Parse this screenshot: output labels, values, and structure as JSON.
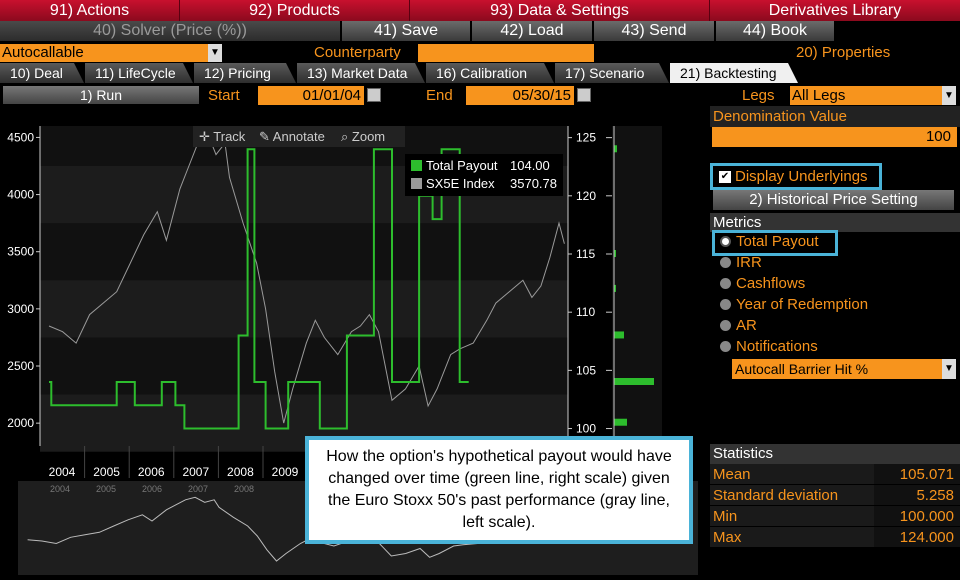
{
  "menu": [
    "91) Actions",
    "92) Products",
    "93) Data & Settings",
    "Derivatives Library"
  ],
  "toolbar": [
    "40) Solver (Price (%))",
    "41) Save",
    "42) Load",
    "43) Send",
    "44) Book"
  ],
  "row3": {
    "product": "Autocallable",
    "counterparty_label": "Counterparty",
    "counterparty_value": "",
    "properties": "20) Properties"
  },
  "tabs": [
    "10) Deal",
    "11) LifeCycle",
    "12) Pricing",
    "13) Market Data",
    "16) Calibration",
    "17) Scenario",
    "21) Backtesting"
  ],
  "run": {
    "run_label": "1) Run",
    "start_label": "Start",
    "start_value": "01/01/04",
    "end_label": "End",
    "end_value": "05/30/15",
    "legs_label": "Legs",
    "legs_value": "All Legs"
  },
  "chart_toolbar": [
    "Track",
    "Annotate",
    "Zoom"
  ],
  "chart_data": {
    "type": "line",
    "x_ticks": [
      "2004",
      "2005",
      "2006",
      "2007",
      "2008",
      "2009"
    ],
    "left_axis": {
      "ticks": [
        2000,
        2500,
        3000,
        3500,
        4000,
        4500
      ],
      "range": [
        1800,
        4600
      ]
    },
    "right_axis": {
      "ticks": [
        100,
        105,
        110,
        115,
        120,
        125
      ],
      "range": [
        98.5,
        126
      ]
    },
    "legend": [
      {
        "name": "Total Payout",
        "value": "104.00",
        "color": "#2dbd2d"
      },
      {
        "name": "SX5E Index",
        "value": "3570.78",
        "color": "#9a9a9a"
      }
    ],
    "mini_ticks": [
      "2004",
      "2005",
      "2006",
      "2007",
      "2008"
    ],
    "sx5e": [
      [
        2004.0,
        2850
      ],
      [
        2004.3,
        2800
      ],
      [
        2004.6,
        2700
      ],
      [
        2004.9,
        2950
      ],
      [
        2005.2,
        3050
      ],
      [
        2005.5,
        3150
      ],
      [
        2005.8,
        3400
      ],
      [
        2006.1,
        3650
      ],
      [
        2006.4,
        3850
      ],
      [
        2006.6,
        3600
      ],
      [
        2006.9,
        4050
      ],
      [
        2007.1,
        4250
      ],
      [
        2007.3,
        4450
      ],
      [
        2007.5,
        4550
      ],
      [
        2007.7,
        4350
      ],
      [
        2007.9,
        4450
      ],
      [
        2008.0,
        4150
      ],
      [
        2008.3,
        3750
      ],
      [
        2008.6,
        3400
      ],
      [
        2008.8,
        3000
      ],
      [
        2009.0,
        2450
      ],
      [
        2009.2,
        2000
      ],
      [
        2009.4,
        2300
      ],
      [
        2009.7,
        2700
      ],
      [
        2009.9,
        2900
      ],
      [
        2010.1,
        2750
      ],
      [
        2010.4,
        2600
      ],
      [
        2010.7,
        2800
      ],
      [
        2010.9,
        2850
      ],
      [
        2011.1,
        2950
      ],
      [
        2011.3,
        2800
      ],
      [
        2011.6,
        2200
      ],
      [
        2011.9,
        2300
      ],
      [
        2012.2,
        2500
      ],
      [
        2012.4,
        2150
      ],
      [
        2012.6,
        2300
      ],
      [
        2012.9,
        2600
      ],
      [
        2013.1,
        2650
      ],
      [
        2013.4,
        2700
      ],
      [
        2013.7,
        2900
      ],
      [
        2013.9,
        3050
      ],
      [
        2014.2,
        3150
      ],
      [
        2014.5,
        3250
      ],
      [
        2014.7,
        3100
      ],
      [
        2014.9,
        3200
      ],
      [
        2015.1,
        3450
      ],
      [
        2015.3,
        3750
      ],
      [
        2015.42,
        3570
      ]
    ],
    "payout": [
      [
        2004.0,
        104
      ],
      [
        2004.05,
        104
      ],
      [
        2004.05,
        102
      ],
      [
        2005.5,
        102
      ],
      [
        2005.5,
        104
      ],
      [
        2005.9,
        104
      ],
      [
        2005.9,
        102
      ],
      [
        2006.5,
        102
      ],
      [
        2006.5,
        104
      ],
      [
        2006.8,
        104
      ],
      [
        2006.8,
        102
      ],
      [
        2007.0,
        102
      ],
      [
        2007.0,
        100
      ],
      [
        2008.2,
        100
      ],
      [
        2008.2,
        108
      ],
      [
        2008.4,
        108
      ],
      [
        2008.4,
        124
      ],
      [
        2008.55,
        124
      ],
      [
        2008.55,
        104
      ],
      [
        2008.8,
        104
      ],
      [
        2008.8,
        100
      ],
      [
        2009.3,
        100
      ],
      [
        2009.3,
        104
      ],
      [
        2010.0,
        104
      ],
      [
        2010.0,
        100
      ],
      [
        2010.6,
        100
      ],
      [
        2010.6,
        108
      ],
      [
        2011.2,
        108
      ],
      [
        2011.2,
        124
      ],
      [
        2011.6,
        124
      ],
      [
        2011.6,
        104
      ],
      [
        2012.2,
        104
      ],
      [
        2012.2,
        120
      ],
      [
        2012.5,
        120
      ],
      [
        2012.5,
        118
      ],
      [
        2012.7,
        118
      ],
      [
        2012.7,
        124
      ],
      [
        2013.1,
        124
      ],
      [
        2013.1,
        104
      ],
      [
        2013.3,
        104
      ]
    ]
  },
  "histogram": {
    "ticks": [
      "125",
      "120",
      "115",
      "110",
      "105",
      "100"
    ],
    "bars": [
      {
        "y": 124,
        "w": 3
      },
      {
        "y": 115,
        "w": 2
      },
      {
        "y": 108,
        "w": 10
      },
      {
        "y": 104,
        "w": 40
      },
      {
        "y": 100.5,
        "w": 13
      },
      {
        "y": 112,
        "w": 2
      }
    ]
  },
  "right": {
    "denom_label": "Denomination Value",
    "denom_value": "100",
    "display_underlyings": "Display Underlyings",
    "hist_price_btn": "2) Historical Price Setting",
    "metrics_label": "Metrics",
    "metrics": [
      "Total Payout",
      "IRR",
      "Cashflows",
      "Year of Redemption",
      "AR",
      "Notifications"
    ],
    "notif_select": "Autocall Barrier Hit %",
    "stats_label": "Statistics",
    "stats": [
      {
        "k": "Mean",
        "v": "105.071"
      },
      {
        "k": "Standard deviation",
        "v": "5.258"
      },
      {
        "k": "Min",
        "v": "100.000"
      },
      {
        "k": "Max",
        "v": "124.000"
      }
    ]
  },
  "callout": "How the option's hypothetical payout would have changed over time (green line, right scale) given the Euro Stoxx 50's past performance (gray line, left scale)."
}
